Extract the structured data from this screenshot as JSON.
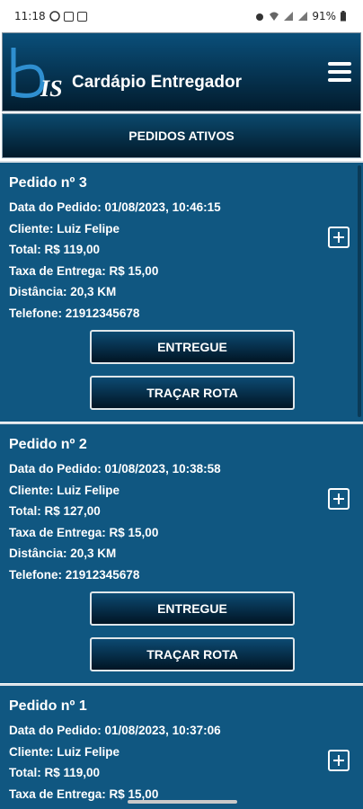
{
  "status_bar": {
    "time": "11:18",
    "battery": "91%"
  },
  "header": {
    "logo_text": "bis",
    "title": "Cardápio Entregador"
  },
  "section": {
    "title": "PEDIDOS ATIVOS"
  },
  "orders": [
    {
      "title": "Pedido nº 3",
      "date": "Data do Pedido: 01/08/2023, 10:46:15",
      "client": "Cliente: Luiz Felipe",
      "total": "Total: R$ 119,00",
      "fee": "Taxa de Entrega: R$ 15,00",
      "distance": "Distância: 20,3 KM",
      "phone": "Telefone: 21912345678",
      "deliver_label": "ENTREGUE",
      "route_label": "TRAÇAR ROTA"
    },
    {
      "title": "Pedido nº 2",
      "date": "Data do Pedido: 01/08/2023, 10:38:58",
      "client": "Cliente: Luiz Felipe",
      "total": "Total: R$ 127,00",
      "fee": "Taxa de Entrega: R$ 15,00",
      "distance": "Distância: 20,3 KM",
      "phone": "Telefone: 21912345678",
      "deliver_label": "ENTREGUE",
      "route_label": "TRAÇAR ROTA"
    },
    {
      "title": "Pedido nº 1",
      "date": "Data do Pedido: 01/08/2023, 10:37:06",
      "client": "Cliente: Luiz Felipe",
      "total": "Total: R$ 119,00",
      "fee": "Taxa de Entrega: R$ 15,00"
    }
  ],
  "colors": {
    "card_bg": "#105781",
    "header_top": "#0a4f7a",
    "header_bottom": "#021c2e"
  }
}
